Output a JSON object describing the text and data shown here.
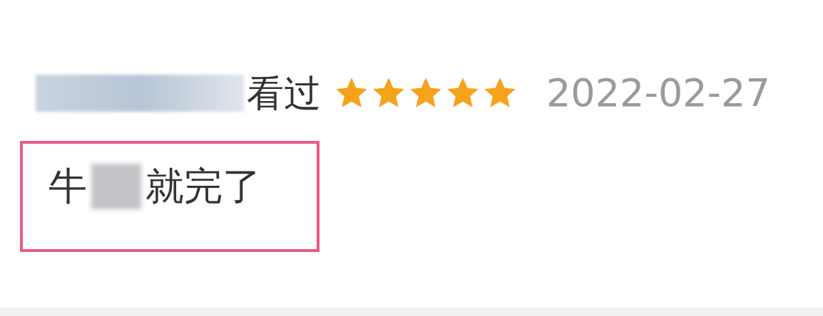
{
  "review": {
    "status": "看过",
    "stars": 5,
    "date": "2022-02-27",
    "comment_parts": [
      {
        "kind": "text",
        "text": "牛"
      },
      {
        "kind": "redacted"
      },
      {
        "kind": "text",
        "text": "就完了"
      }
    ],
    "highlighted": true
  }
}
